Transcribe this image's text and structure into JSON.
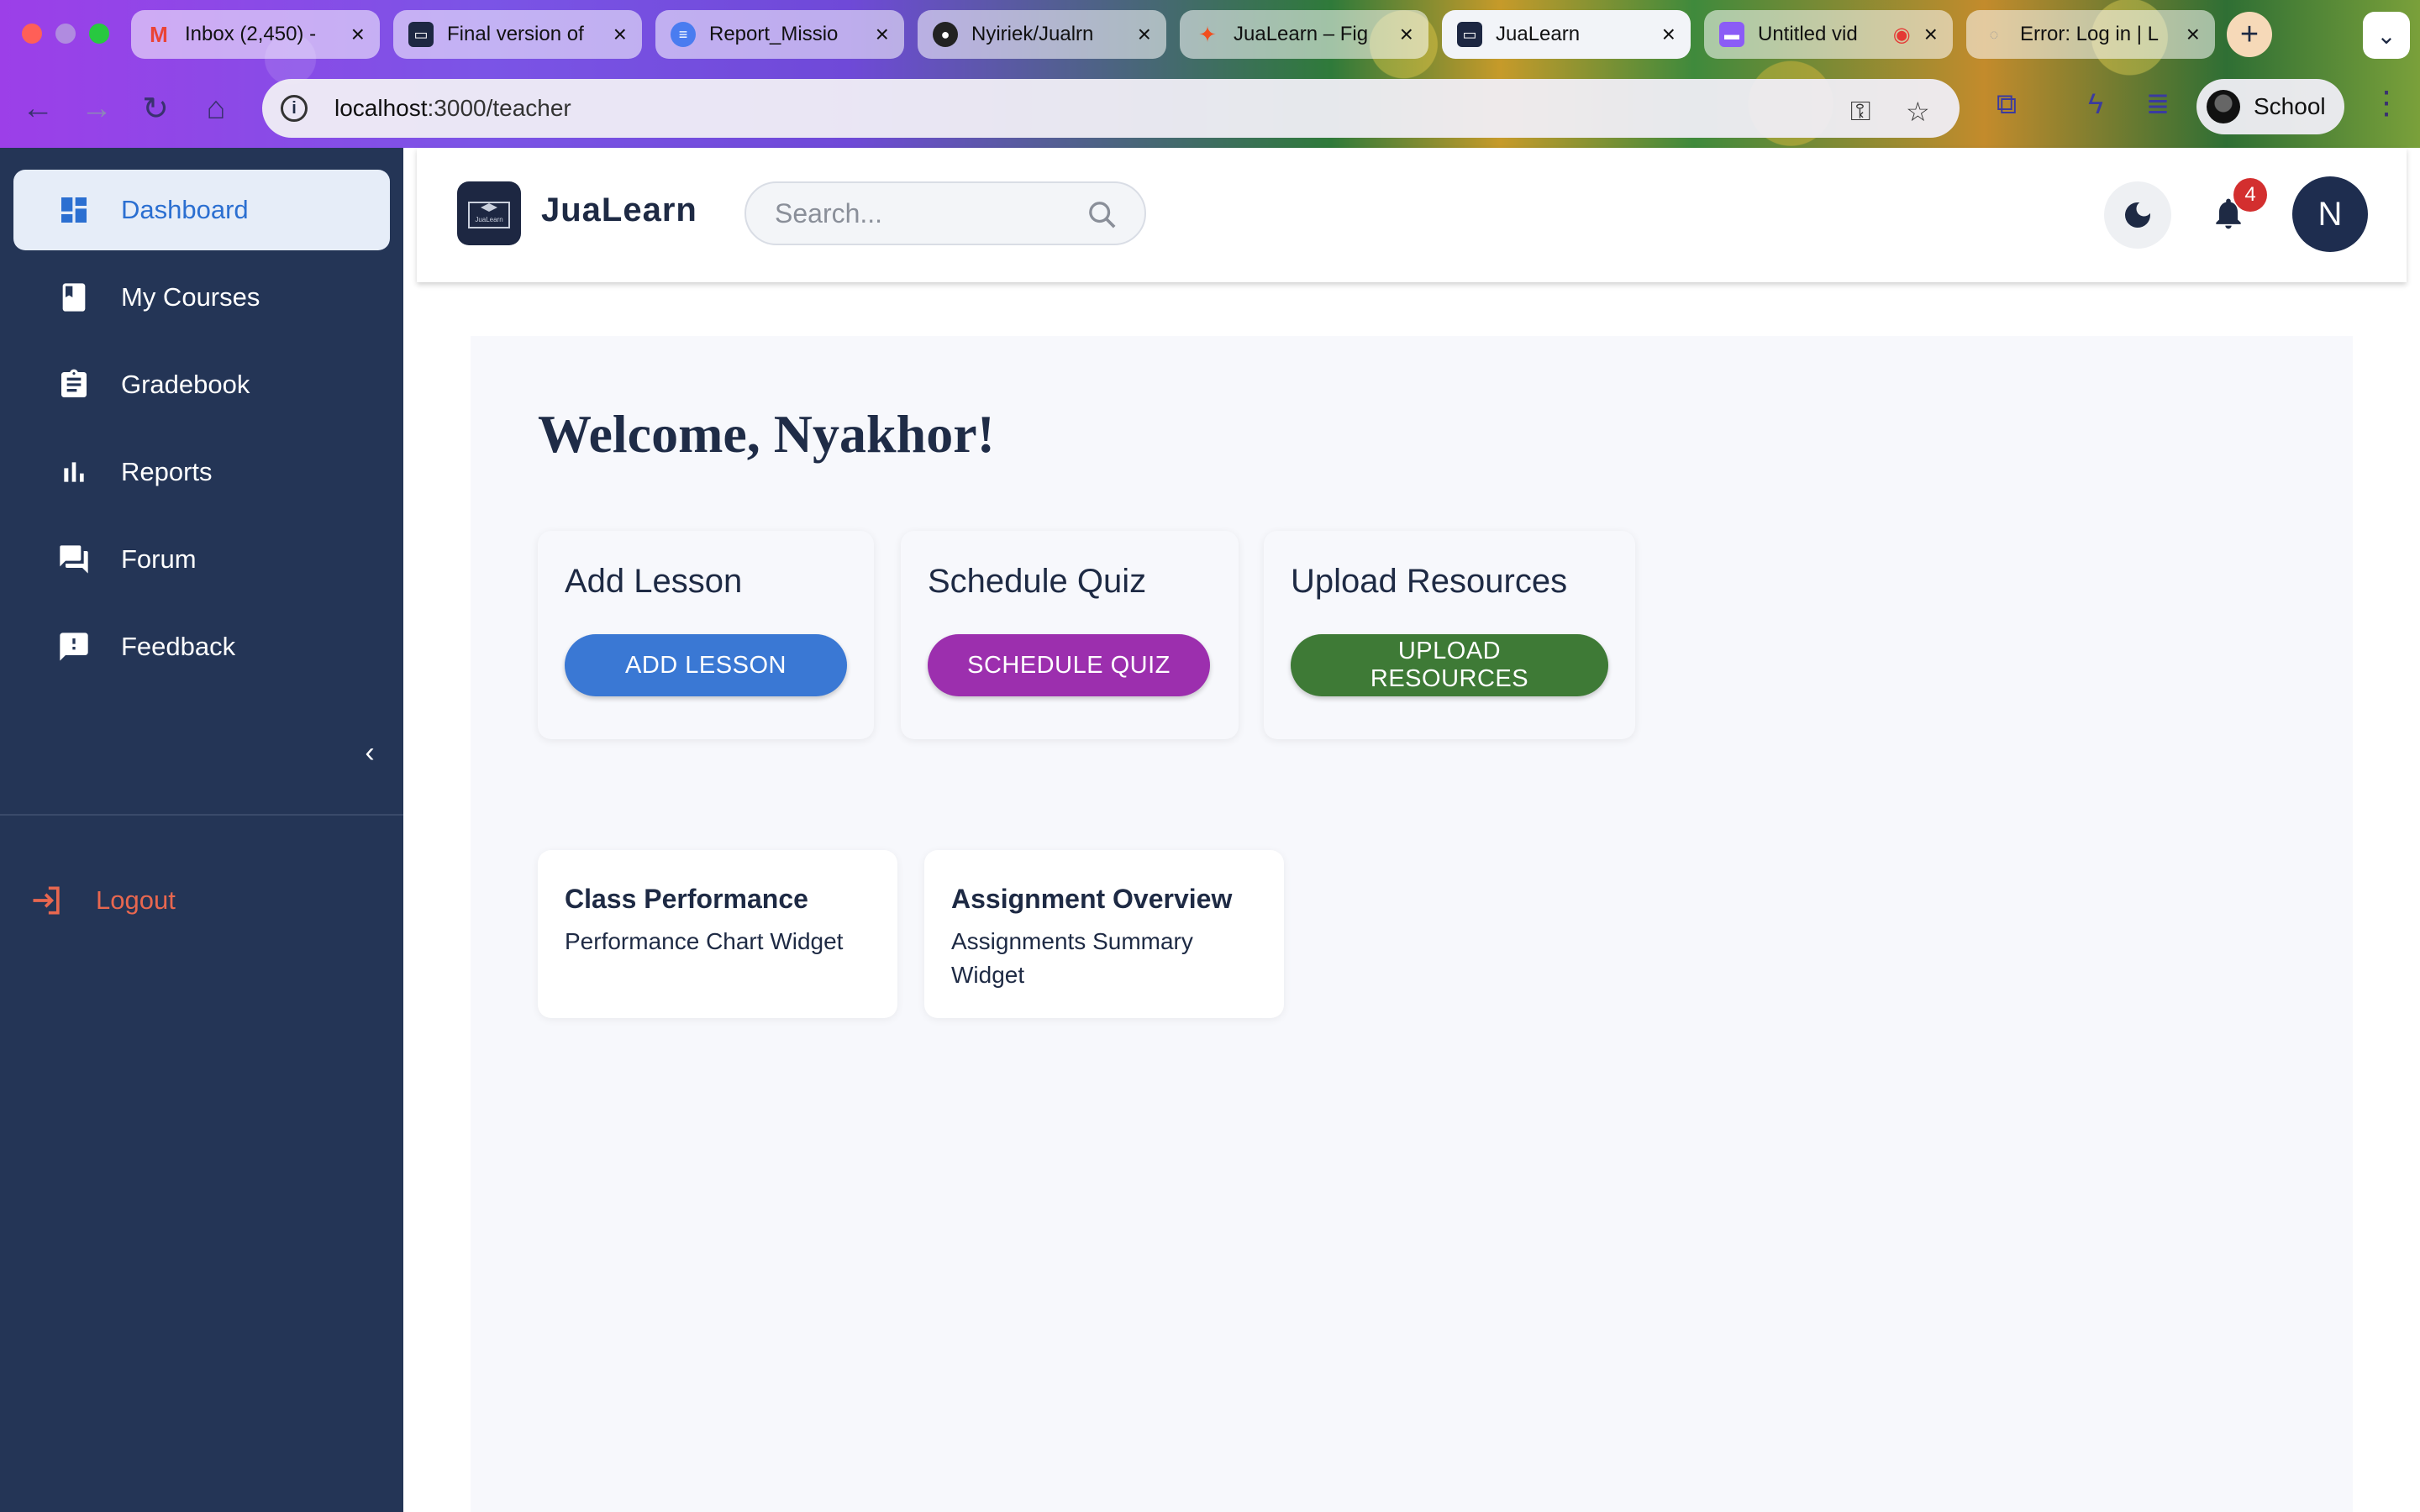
{
  "browser": {
    "tabs": [
      {
        "label": "Inbox (2,450) -",
        "favicon": "gmail-icon",
        "color": "#ea4335"
      },
      {
        "label": "Final version of",
        "favicon": "slides-icon",
        "color": "#1d2742"
      },
      {
        "label": "Report_Missio",
        "favicon": "docs-icon",
        "color": "#4a7cf0"
      },
      {
        "label": "Nyiriek/Jualrn",
        "favicon": "github-icon",
        "color": "#222222"
      },
      {
        "label": "JuaLearn – Fig",
        "favicon": "figma-icon",
        "color": "#f24e1e"
      },
      {
        "label": "JuaLearn",
        "favicon": "jualearn-icon",
        "color": "#1d2742"
      },
      {
        "label": "Untitled vid",
        "favicon": "video-icon",
        "color": "#8b5cf6"
      },
      {
        "label": "Error: Log in | L",
        "favicon": "globe-icon",
        "color": "#999999"
      }
    ],
    "url_host": "localhost",
    "url_path": ":3000/teacher",
    "profile_label": "School"
  },
  "sidebar": {
    "items": [
      {
        "label": "Dashboard",
        "icon": "dashboard-icon"
      },
      {
        "label": "My Courses",
        "icon": "book-icon"
      },
      {
        "label": "Gradebook",
        "icon": "clipboard-icon"
      },
      {
        "label": "Reports",
        "icon": "bar-chart-icon"
      },
      {
        "label": "Forum",
        "icon": "forum-icon"
      },
      {
        "label": "Feedback",
        "icon": "feedback-icon"
      }
    ],
    "logout_label": "Logout"
  },
  "header": {
    "brand": "JuaLearn",
    "logo_text": "JuaLearn",
    "search_placeholder": "Search...",
    "notification_count": "4",
    "avatar_initial": "N"
  },
  "main": {
    "welcome": "Welcome, Nyakhor!",
    "actions": [
      {
        "title": "Add Lesson",
        "button": "ADD LESSON",
        "color": "#3a78d4"
      },
      {
        "title": "Schedule Quiz",
        "button": "SCHEDULE QUIZ",
        "color": "#9c2fae"
      },
      {
        "title": "Upload Resources",
        "button": "UPLOAD RESOURCES",
        "color": "#3e7a36"
      }
    ],
    "widgets": [
      {
        "title": "Class Performance",
        "subtitle": "Performance Chart Widget"
      },
      {
        "title": "Assignment Overview",
        "subtitle": "Assignments Summary Widget"
      }
    ]
  }
}
